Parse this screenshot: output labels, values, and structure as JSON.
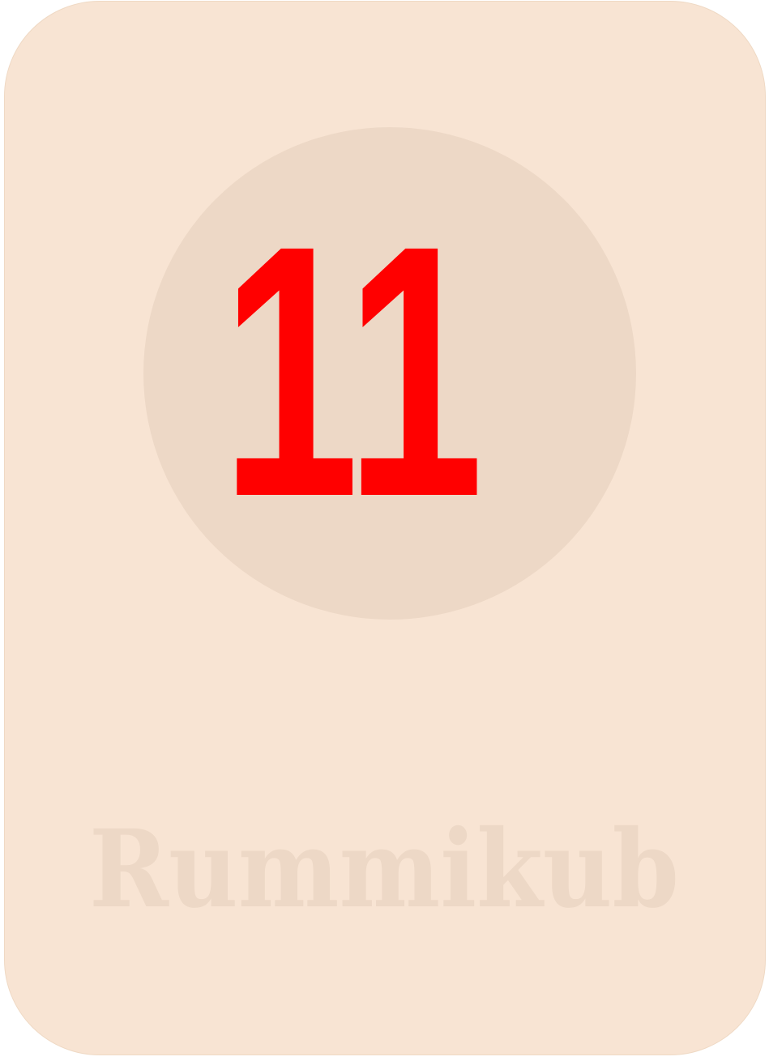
{
  "tile": {
    "number": "11",
    "brand": "Rummikub",
    "number_color": "#ff0000",
    "tile_color": "#f8e4d3",
    "circle_color": "#edd8c6",
    "brand_color": "#edd8c6"
  }
}
